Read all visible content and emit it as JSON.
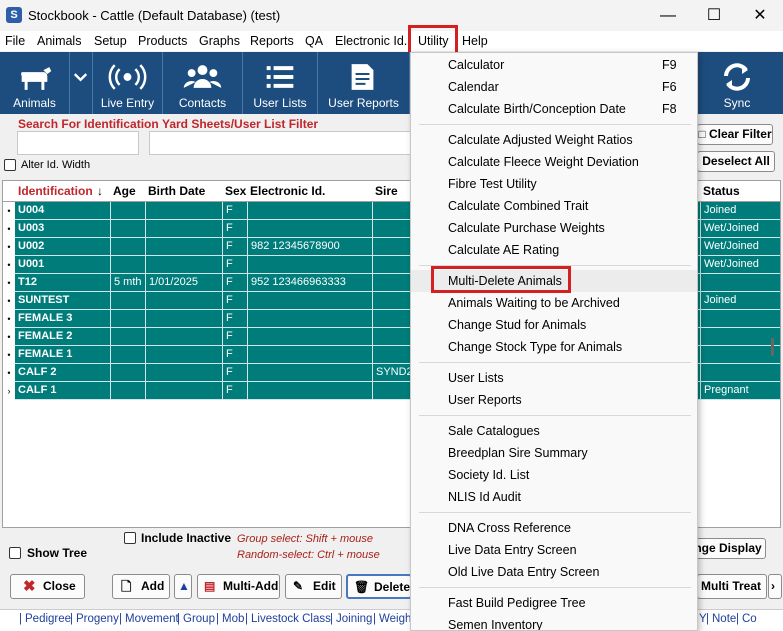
{
  "window": {
    "title": "Stockbook - Cattle (Default Database) (test)",
    "app_icon": "S"
  },
  "menu": [
    "File",
    "Animals",
    "Setup",
    "Products",
    "Graphs",
    "Reports",
    "QA",
    "Electronic Id.",
    "Utility",
    "Help"
  ],
  "toolbar": [
    {
      "label": "Animals",
      "icon": "cow-icon"
    },
    {
      "label": "Live Entry",
      "icon": "broadcast-icon"
    },
    {
      "label": "Contacts",
      "icon": "people-icon"
    },
    {
      "label": "User Lists",
      "icon": "list-icon"
    },
    {
      "label": "User Reports",
      "icon": "report-icon"
    },
    {
      "label": "Sync",
      "icon": "sync-icon"
    }
  ],
  "search": {
    "identification_label": "Search For Identification",
    "filter_label": "Yard Sheets/User List Filter",
    "alter_width_label": "Alter Id. Width",
    "clear_filter": "Clear Filter",
    "deselect_all": "Deselect All"
  },
  "grid": {
    "headers": [
      "Identification",
      "Age",
      "Birth Date",
      "Sex",
      "Electronic Id.",
      "Sire",
      "Status"
    ],
    "rows": [
      {
        "id": "U004",
        "age": "",
        "birth": "",
        "sex": "F",
        "eid": "",
        "sire": "",
        "status": "Joined",
        "marker": "•"
      },
      {
        "id": "U003",
        "age": "",
        "birth": "",
        "sex": "F",
        "eid": "",
        "sire": "",
        "status": "Wet/Joined",
        "marker": "•"
      },
      {
        "id": "U002",
        "age": "",
        "birth": "",
        "sex": "F",
        "eid": "982 12345678900",
        "sire": "",
        "status": "Wet/Joined",
        "marker": "•"
      },
      {
        "id": "U001",
        "age": "",
        "birth": "",
        "sex": "F",
        "eid": "",
        "sire": "",
        "status": "Wet/Joined",
        "marker": "•"
      },
      {
        "id": "T12",
        "age": "5 mth",
        "birth": "1/01/2025",
        "sex": "F",
        "eid": "952 123466963333",
        "sire": "",
        "status": "",
        "marker": "•"
      },
      {
        "id": "SUNTEST",
        "age": "",
        "birth": "",
        "sex": "F",
        "eid": "",
        "sire": "",
        "status": "Joined",
        "marker": "•"
      },
      {
        "id": "FEMALE 3",
        "age": "",
        "birth": "",
        "sex": "F",
        "eid": "",
        "sire": "",
        "status": "",
        "marker": "•"
      },
      {
        "id": "FEMALE 2",
        "age": "",
        "birth": "",
        "sex": "F",
        "eid": "",
        "sire": "",
        "status": "",
        "marker": "•"
      },
      {
        "id": "FEMALE 1",
        "age": "",
        "birth": "",
        "sex": "F",
        "eid": "",
        "sire": "",
        "status": "",
        "marker": "•"
      },
      {
        "id": "CALF 2",
        "age": "",
        "birth": "",
        "sex": "F",
        "eid": "",
        "sire": "SYND2",
        "status": "",
        "marker": "•"
      },
      {
        "id": "CALF 1",
        "age": "",
        "birth": "",
        "sex": "F",
        "eid": "",
        "sire": "",
        "status": "Pregnant",
        "marker": "›"
      }
    ]
  },
  "bottom": {
    "include_inactive": "Include Inactive",
    "show_tree": "Show Tree",
    "group_select": "Group select: Shift + mouse",
    "random_select": "Random-select: Ctrl + mouse",
    "change_display": "nge Display",
    "buttons": [
      "Close",
      "Add",
      "Multi-Add",
      "Edit",
      "Delete",
      "Multi Treat"
    ]
  },
  "tabs": [
    "Pedigree",
    "Progeny",
    "Movement",
    "Group",
    "Mob",
    "Livestock Class",
    "Joining",
    "Weight"
  ],
  "tabs_right": [
    "Y",
    "Note",
    "Co"
  ],
  "utility_menu": [
    {
      "label": "Calculator",
      "shortcut": "F9"
    },
    {
      "label": "Calendar",
      "shortcut": "F6"
    },
    {
      "label": "Calculate Birth/Conception Date",
      "shortcut": "F8"
    },
    {
      "sep": true
    },
    {
      "label": "Calculate Adjusted Weight Ratios"
    },
    {
      "label": "Calculate Fleece Weight Deviation"
    },
    {
      "label": "Fibre Test Utility"
    },
    {
      "label": "Calculate Combined Trait"
    },
    {
      "label": "Calculate Purchase Weights"
    },
    {
      "label": "Calculate AE Rating"
    },
    {
      "sep": true
    },
    {
      "label": "Multi-Delete Animals",
      "highlight": true
    },
    {
      "label": "Animals Waiting to be Archived"
    },
    {
      "label": "Change Stud for Animals"
    },
    {
      "label": "Change Stock Type for Animals"
    },
    {
      "sep": true
    },
    {
      "label": "User Lists"
    },
    {
      "label": "User Reports"
    },
    {
      "sep": true
    },
    {
      "label": "Sale Catalogues"
    },
    {
      "label": "Breedplan Sire Summary"
    },
    {
      "label": "Society Id. List"
    },
    {
      "label": "NLIS Id Audit"
    },
    {
      "sep": true
    },
    {
      "label": "DNA Cross Reference"
    },
    {
      "label": "Live Data Entry Screen"
    },
    {
      "label": "Old Live Data Entry Screen"
    },
    {
      "sep": true
    },
    {
      "label": "Fast Build Pedigree Tree"
    },
    {
      "label": "Semen Inventory"
    }
  ]
}
